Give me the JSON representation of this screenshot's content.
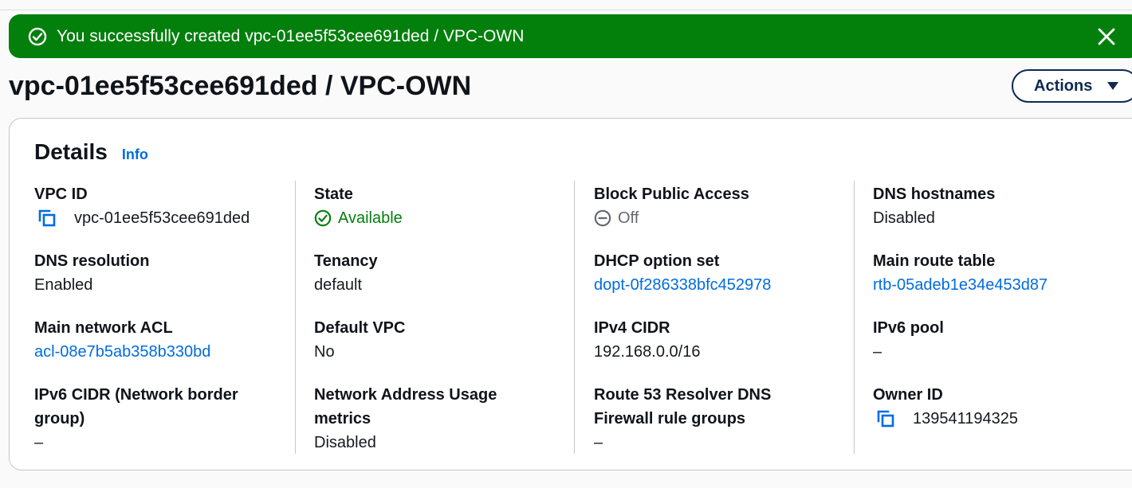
{
  "flash": {
    "message": "You successfully created vpc-01ee5f53cee691ded / VPC-OWN",
    "icon": "check-circle-icon",
    "close_icon": "close-icon",
    "color": "#037f0c"
  },
  "header": {
    "title": "vpc-01ee5f53cee691ded / VPC-OWN",
    "actions_label": "Actions"
  },
  "details": {
    "title": "Details",
    "info_label": "Info",
    "columns": [
      [
        {
          "label": "VPC ID",
          "value": "vpc-01ee5f53cee691ded",
          "kind": "copy"
        },
        {
          "label": "DNS resolution",
          "value": "Enabled",
          "kind": "text"
        },
        {
          "label": "Main network ACL",
          "value": "acl-08e7b5ab358b330bd",
          "kind": "link"
        },
        {
          "label": "IPv6 CIDR (Network border group)",
          "value": "–",
          "kind": "text"
        }
      ],
      [
        {
          "label": "State",
          "value": "Available",
          "kind": "success"
        },
        {
          "label": "Tenancy",
          "value": "default",
          "kind": "text"
        },
        {
          "label": "Default VPC",
          "value": "No",
          "kind": "text"
        },
        {
          "label": "Network Address Usage metrics",
          "value": "Disabled",
          "kind": "text"
        }
      ],
      [
        {
          "label": "Block Public Access",
          "value": "Off",
          "kind": "off"
        },
        {
          "label": "DHCP option set",
          "value": "dopt-0f286338bfc452978",
          "kind": "link"
        },
        {
          "label": "IPv4 CIDR",
          "value": "192.168.0.0/16",
          "kind": "text"
        },
        {
          "label": "Route 53 Resolver DNS Firewall rule groups",
          "value": "–",
          "kind": "text"
        }
      ],
      [
        {
          "label": "DNS hostnames",
          "value": "Disabled",
          "kind": "text"
        },
        {
          "label": "Main route table",
          "value": "rtb-05adeb1e34e453d87",
          "kind": "link"
        },
        {
          "label": "IPv6 pool",
          "value": "–",
          "kind": "text"
        },
        {
          "label": "Owner ID",
          "value": "139541194325",
          "kind": "copy"
        }
      ]
    ]
  },
  "colors": {
    "link": "#006ce0",
    "success": "#037f0c",
    "primary_dark": "#0f2a52"
  }
}
